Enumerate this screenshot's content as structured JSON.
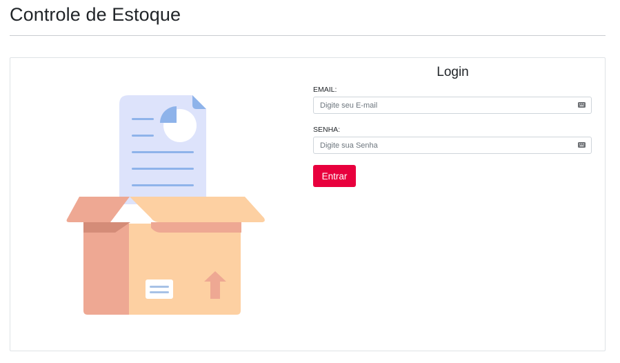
{
  "header": {
    "title": "Controle de Estoque"
  },
  "login": {
    "title": "Login",
    "email": {
      "label": "EMAIL:",
      "placeholder": "Digite seu E-mail",
      "value": ""
    },
    "senha": {
      "label": "SENHA:",
      "placeholder": "Digite sua Senha",
      "value": ""
    },
    "submit_label": "Entrar"
  },
  "colors": {
    "accent": "#e8003d",
    "box_front": "#fdd0a2",
    "box_side": "#eea893",
    "document": "#dde3fb",
    "document_lines": "#8eb3ea"
  },
  "icons": {
    "illustration": "open-box-with-document-icon",
    "field_suffix": "keyboard-icon"
  }
}
